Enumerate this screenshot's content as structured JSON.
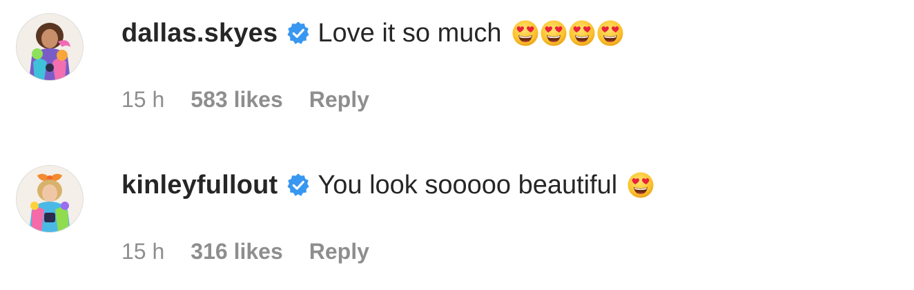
{
  "comments": [
    {
      "username": "dallas.skyes",
      "verified": true,
      "text": "Love it so much",
      "emoji": [
        "heart-eyes",
        "heart-eyes",
        "heart-eyes",
        "heart-eyes"
      ],
      "time": "15 h",
      "likes": "583 likes",
      "reply_label": "Reply"
    },
    {
      "username": "kinleyfullout",
      "verified": true,
      "text": "You look sooooo beautiful",
      "emoji": [
        "heart-eyes"
      ],
      "time": "15 h",
      "likes": "316 likes",
      "reply_label": "Reply"
    }
  ],
  "colors": {
    "text": "#262626",
    "meta": "#8e8e8e",
    "verified_blue": "#3897f0",
    "emoji_yellow": "#f8b72d",
    "emoji_heart": "#e8223b"
  },
  "icons": {
    "verified": "verified-badge-icon",
    "emoji": "heart-eyes-emoji-icon"
  }
}
